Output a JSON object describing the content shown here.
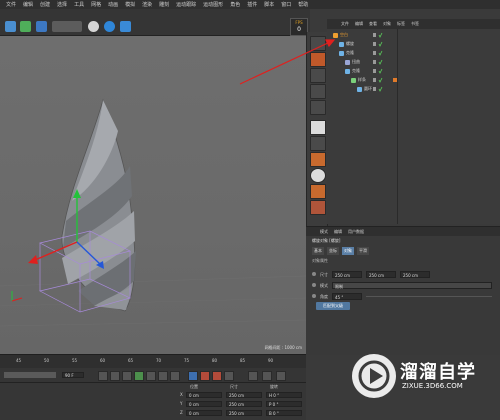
{
  "menubar": {
    "items": [
      "文件",
      "编辑",
      "创建",
      "选择",
      "工具",
      "网格",
      "动画",
      "模拟",
      "渲染",
      "雕刻",
      "运动跟踪",
      "运动图形",
      "角色",
      "插件",
      "脚本",
      "窗口",
      "帮助"
    ]
  },
  "viewport": {
    "fps_label": "FPS",
    "fps_value": "0",
    "grid_status": "网格间距 : 1000 cm"
  },
  "object_manager": {
    "tabs": [
      "文件",
      "编辑",
      "查看",
      "对象",
      "标签",
      "书签"
    ],
    "tree": [
      {
        "label": "空白",
        "indent": 0,
        "selected": true
      },
      {
        "label": "螺旋",
        "indent": 1,
        "selected": false
      },
      {
        "label": "克隆",
        "indent": 1,
        "selected": false
      },
      {
        "label": "扭曲",
        "indent": 2,
        "selected": false
      },
      {
        "label": "克隆",
        "indent": 2,
        "selected": false
      },
      {
        "label": "样条",
        "indent": 3,
        "selected": false
      },
      {
        "label": "圆环",
        "indent": 4,
        "selected": false
      }
    ]
  },
  "attribute_manager": {
    "tabs": [
      "模式",
      "编辑",
      "用户数据"
    ],
    "header": "螺旋对象 [螺旋]",
    "subtabs": [
      {
        "label": "基本",
        "active": false
      },
      {
        "label": "坐标",
        "active": false
      },
      {
        "label": "对象",
        "active": true
      },
      {
        "label": "平滑",
        "active": false
      }
    ],
    "section": "对象属性",
    "params": [
      {
        "label": "尺寸",
        "values": [
          "250 cm",
          "250 cm",
          "250 cm"
        ]
      },
      {
        "label": "模式",
        "values": [
          "限制"
        ]
      },
      {
        "label": "角度",
        "values": [
          "45 °"
        ]
      }
    ],
    "reset_button": "匹配到父级"
  },
  "timeline": {
    "ticks": [
      "45",
      "50",
      "55",
      "60",
      "65",
      "70",
      "75",
      "80",
      "85",
      "90"
    ],
    "frame_field": "90 F"
  },
  "coords": {
    "headers": [
      "位置",
      "尺寸",
      "旋转"
    ],
    "rows": [
      {
        "axis": "X",
        "pos": "0 cm",
        "size": "250 cm",
        "rot": "H  0 °"
      },
      {
        "axis": "Y",
        "pos": "0 cm",
        "size": "250 cm",
        "rot": "P  0 °"
      },
      {
        "axis": "Z",
        "pos": "0 cm",
        "size": "250 cm",
        "rot": "B  0 °"
      }
    ]
  },
  "watermark": {
    "title": "溜溜自学",
    "subtitle": "ZIXUE.3D66.COM"
  },
  "colors": {
    "accent_blue": "#5178a0",
    "selected_orange": "#f0a030",
    "arrow_red": "#e0201e"
  }
}
